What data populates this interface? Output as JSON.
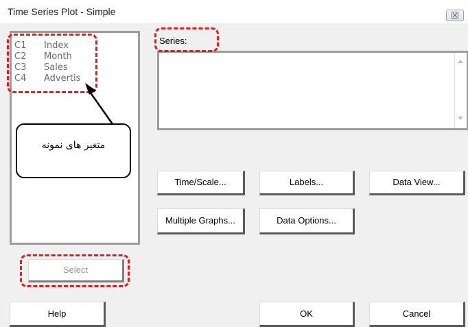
{
  "window": {
    "title": "Time Series Plot - Simple",
    "close_symbol": "☒"
  },
  "variables": [
    {
      "col": "C1",
      "name": "Index"
    },
    {
      "col": "C2",
      "name": "Month"
    },
    {
      "col": "C3",
      "name": "Sales"
    },
    {
      "col": "C4",
      "name": "Advertis"
    }
  ],
  "series": {
    "label": "Series:",
    "value": ""
  },
  "buttons": {
    "time_scale": "Time/Scale...",
    "labels": "Labels...",
    "data_view": "Data View...",
    "multiple_graphs": "Multiple Graphs...",
    "data_options": "Data Options...",
    "select": "Select",
    "help": "Help",
    "ok": "OK",
    "cancel": "Cancel"
  },
  "annotation": {
    "callout_text": "متغیر های نمونه",
    "highlight_color": "#e31b1b"
  }
}
